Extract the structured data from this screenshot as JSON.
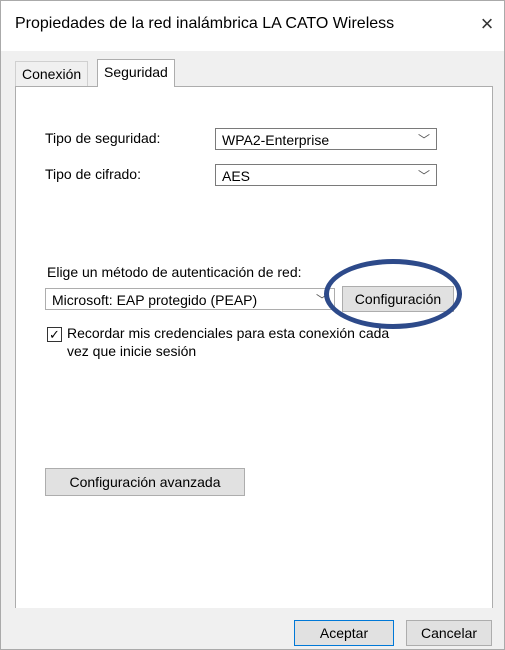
{
  "window": {
    "title": "Propiedades de la red inalámbrica LA CATO Wireless",
    "close_icon": "×"
  },
  "tabs": [
    {
      "label": "Conexión",
      "active": false
    },
    {
      "label": "Seguridad",
      "active": true
    }
  ],
  "security": {
    "type_label": "Tipo de seguridad:",
    "type_value": "WPA2-Enterprise",
    "cipher_label": "Tipo de cifrado:",
    "cipher_value": "AES"
  },
  "auth": {
    "method_label": "Elige un método de autenticación de red:",
    "method_value": "Microsoft: EAP protegido (PEAP)",
    "settings_button": "Configuración",
    "remember_line1": "Recordar mis credenciales para esta conexión cada",
    "remember_line2": "vez que inicie sesión",
    "remember_checked": true
  },
  "advanced_button": "Configuración avanzada",
  "footer": {
    "ok": "Aceptar",
    "cancel": "Cancelar"
  },
  "colors": {
    "highlight_ring": "#2d4a8a",
    "focus_border": "#0078d7"
  }
}
